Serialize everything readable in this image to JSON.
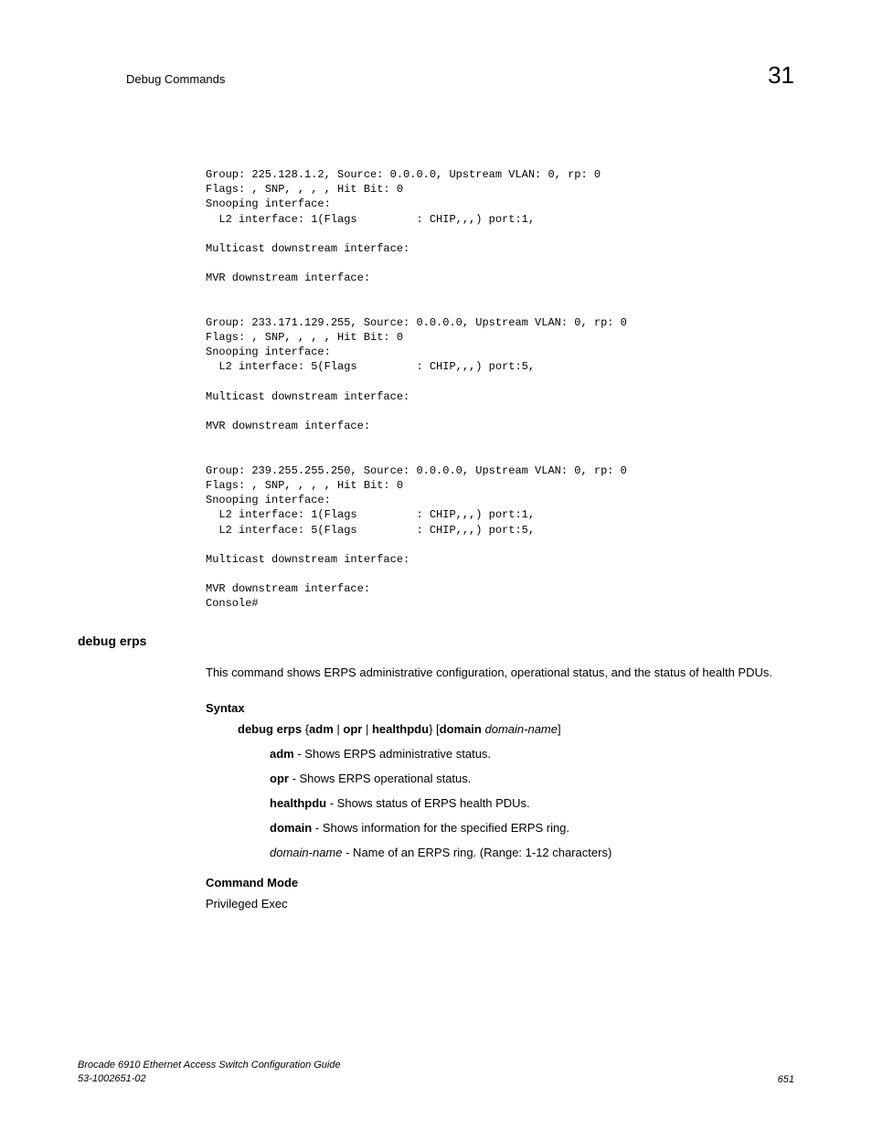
{
  "header": {
    "title": "Debug Commands",
    "chapter": "31"
  },
  "codeBlock": "Group: 225.128.1.2, Source: 0.0.0.0, Upstream VLAN: 0, rp: 0\nFlags: , SNP, , , , Hit Bit: 0\nSnooping interface:\n  L2 interface: 1(Flags         : CHIP,,,) port:1,\n\nMulticast downstream interface:\n\nMVR downstream interface:\n\n\nGroup: 233.171.129.255, Source: 0.0.0.0, Upstream VLAN: 0, rp: 0\nFlags: , SNP, , , , Hit Bit: 0\nSnooping interface:\n  L2 interface: 5(Flags         : CHIP,,,) port:5,\n\nMulticast downstream interface:\n\nMVR downstream interface:\n\n\nGroup: 239.255.255.250, Source: 0.0.0.0, Upstream VLAN: 0, rp: 0\nFlags: , SNP, , , , Hit Bit: 0\nSnooping interface:\n  L2 interface: 1(Flags         : CHIP,,,) port:1,\n  L2 interface: 5(Flags         : CHIP,,,) port:5,\n\nMulticast downstream interface:\n\nMVR downstream interface:\nConsole#",
  "section": {
    "title": "debug erps",
    "description": "This command shows ERPS administrative configuration, operational status, and the status of health PDUs."
  },
  "syntax": {
    "heading": "Syntax",
    "command": "debug erps",
    "options": " {",
    "opt1": "adm",
    "sep1": " | ",
    "opt2": "opr",
    "sep2": " | ",
    "opt3": "healthpdu",
    "close1": "} [",
    "opt4": "domain",
    "space": " ",
    "param": "domain-name",
    "close2": "]"
  },
  "params": {
    "adm": {
      "name": "adm",
      "desc": " - Shows ERPS administrative status."
    },
    "opr": {
      "name": "opr",
      "desc": " - Shows ERPS operational status."
    },
    "healthpdu": {
      "name": "healthpdu",
      "desc": " - Shows status of ERPS health PDUs."
    },
    "domain": {
      "name": "domain",
      "desc": " - Shows information for the specified ERPS ring."
    },
    "domainName": {
      "name": "domain-name",
      "desc": " - Name of an ERPS ring. (Range: 1-12 characters)"
    }
  },
  "commandMode": {
    "heading": "Command Mode",
    "value": "Privileged Exec"
  },
  "footer": {
    "line1": "Brocade 6910 Ethernet Access Switch Configuration Guide",
    "line2": "53-1002651-02",
    "pageNum": "651"
  }
}
